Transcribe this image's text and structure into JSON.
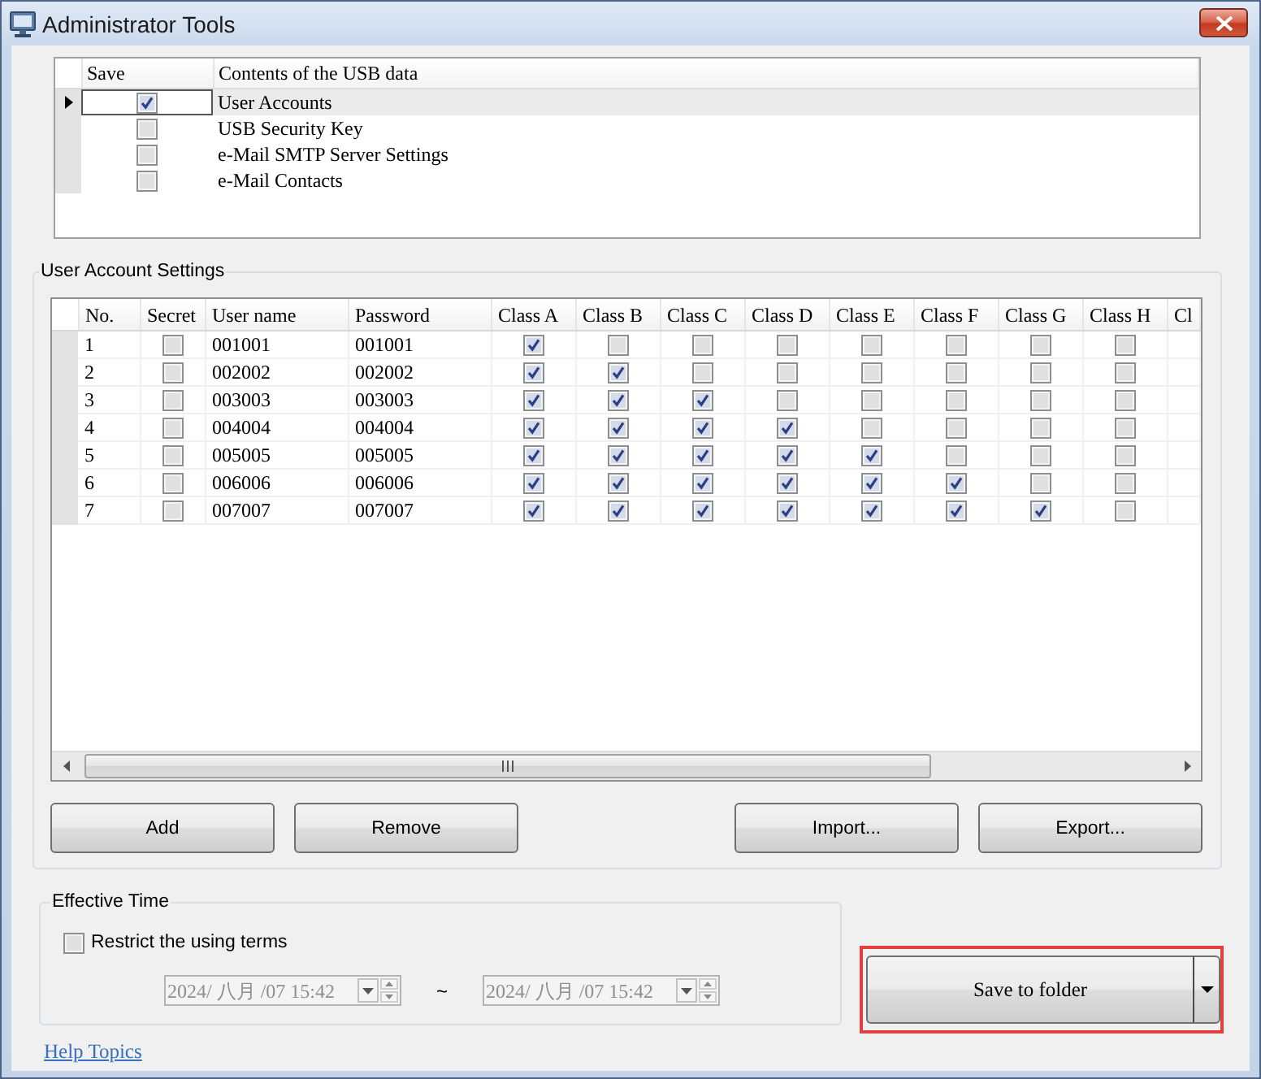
{
  "window": {
    "title": "Administrator Tools"
  },
  "usb_data": {
    "columns": [
      "Save",
      "Contents of the USB data"
    ],
    "rows": [
      {
        "save": true,
        "content": "User Accounts",
        "selected": true
      },
      {
        "save": false,
        "content": "USB Security Key",
        "selected": false
      },
      {
        "save": false,
        "content": "e-Mail SMTP Server Settings",
        "selected": false
      },
      {
        "save": false,
        "content": "e-Mail Contacts",
        "selected": false
      }
    ]
  },
  "user_account_settings": {
    "title": "User Account Settings",
    "columns": [
      "No.",
      "Secret",
      "User name",
      "Password",
      "Class A",
      "Class B",
      "Class C",
      "Class D",
      "Class E",
      "Class F",
      "Class G",
      "Class H",
      "Cl"
    ],
    "rows": [
      {
        "no": "1",
        "secret": false,
        "user_name": "001001",
        "password": "001001",
        "classes": [
          true,
          false,
          false,
          false,
          false,
          false,
          false,
          false
        ]
      },
      {
        "no": "2",
        "secret": false,
        "user_name": "002002",
        "password": "002002",
        "classes": [
          true,
          true,
          false,
          false,
          false,
          false,
          false,
          false
        ]
      },
      {
        "no": "3",
        "secret": false,
        "user_name": "003003",
        "password": "003003",
        "classes": [
          true,
          true,
          true,
          false,
          false,
          false,
          false,
          false
        ]
      },
      {
        "no": "4",
        "secret": false,
        "user_name": "004004",
        "password": "004004",
        "classes": [
          true,
          true,
          true,
          true,
          false,
          false,
          false,
          false
        ]
      },
      {
        "no": "5",
        "secret": false,
        "user_name": "005005",
        "password": "005005",
        "classes": [
          true,
          true,
          true,
          true,
          true,
          false,
          false,
          false
        ]
      },
      {
        "no": "6",
        "secret": false,
        "user_name": "006006",
        "password": "006006",
        "classes": [
          true,
          true,
          true,
          true,
          true,
          true,
          false,
          false
        ]
      },
      {
        "no": "7",
        "secret": false,
        "user_name": "007007",
        "password": "007007",
        "classes": [
          true,
          true,
          true,
          true,
          true,
          true,
          true,
          false
        ]
      }
    ],
    "buttons": [
      [
        "Add",
        "Remove"
      ],
      [
        "Import...",
        "Export..."
      ]
    ]
  },
  "effective_time": {
    "title": "Effective Time",
    "restrict": {
      "label": "Restrict the using terms",
      "checked": false
    },
    "from": {
      "value": "2024/ 八月 /07 15:42",
      "disabled": true
    },
    "separator": "~",
    "to": {
      "value": "2024/ 八月 /07 15:42",
      "disabled": true
    }
  },
  "save_button": {
    "label": "Save to folder",
    "highlighted": true
  },
  "help_link": "Help Topics"
}
